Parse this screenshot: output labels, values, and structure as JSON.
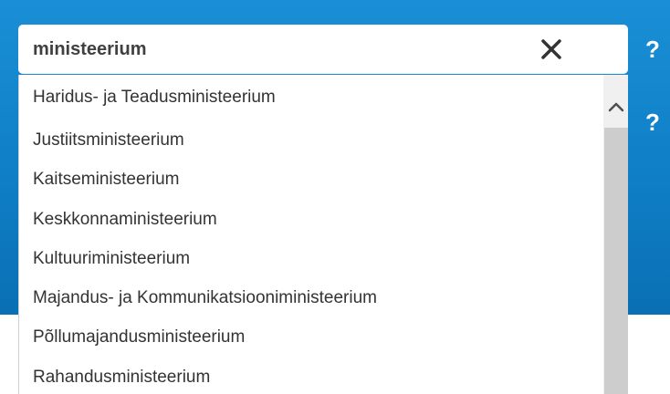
{
  "search": {
    "value": "ministeerium",
    "clear_icon": "close-x-icon"
  },
  "help": {
    "label": "?"
  },
  "dropdown": {
    "options": [
      "Haridus- ja Teadusministeerium",
      "Justiitsministeerium",
      "Kaitseministeerium",
      "Keskkonnaministeerium",
      "Kultuuriministeerium",
      "Majandus- ja Kommunikatsiooniministeerium",
      "Põllumajandusministeerium",
      "Rahandusministeerium"
    ]
  },
  "colors": {
    "panel_blue": "#0f7fc7",
    "scroll_thumb": "#cdcdcd",
    "text": "#333333"
  }
}
